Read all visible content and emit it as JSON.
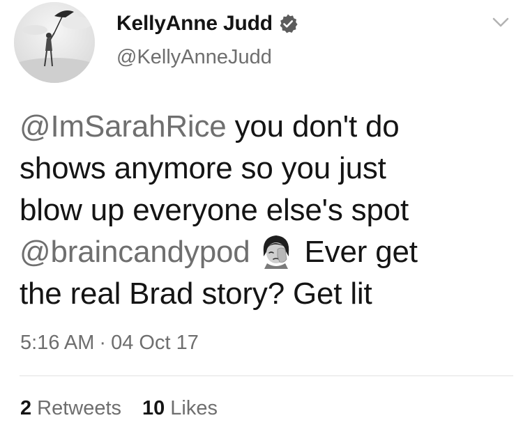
{
  "author": {
    "display_name": "KellyAnne Judd",
    "handle": "@KellyAnneJudd",
    "verified": true,
    "avatar_icon": "profile-photo-umbrella"
  },
  "tweet": {
    "line1_mention": "@ImSarahRice",
    "line1_text": " you don't do",
    "line2_text": "shows anymore so you just",
    "line3_text": "blow up everyone else's spot",
    "line4_mention": "@braincandypod",
    "line4_emoji": "face-palm-woman-emoji",
    "line4_text": "Ever get",
    "line5_text": "the real Brad story? Get lit"
  },
  "meta": {
    "time": "5:16 AM",
    "separator": "·",
    "date": "04 Oct 17"
  },
  "stats": {
    "retweets_count": "2",
    "retweets_label": "Retweets",
    "likes_count": "10",
    "likes_label": "Likes"
  },
  "colors": {
    "text": "#141414",
    "secondary": "#6e6e6e",
    "mention": "#6f6f6f",
    "divider": "#e1e1e1"
  },
  "icons": {
    "verified": "verified-badge-icon",
    "more": "chevron-down-icon"
  }
}
